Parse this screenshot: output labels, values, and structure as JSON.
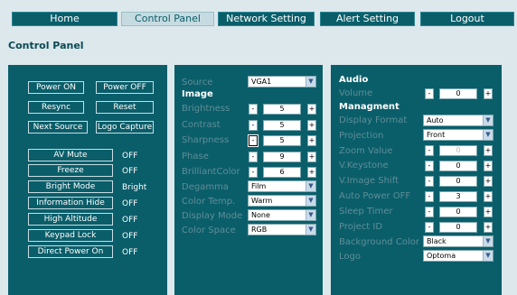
{
  "nav": {
    "home": "Home",
    "control_panel": "Control Panel",
    "network_setting": "Network Setting",
    "alert_setting": "Alert Setting",
    "logout": "Logout"
  },
  "page_title": "Control Panel",
  "left": {
    "power_on": "Power ON",
    "power_off": "Power OFF",
    "resync": "Resync",
    "reset": "Reset",
    "next_source": "Next Source",
    "logo_capture": "Logo Capture",
    "toggles": [
      {
        "label": "AV Mute",
        "value": "OFF"
      },
      {
        "label": "Freeze",
        "value": "OFF"
      },
      {
        "label": "Bright Mode",
        "value": "Bright"
      },
      {
        "label": "Information Hide",
        "value": "OFF"
      },
      {
        "label": "High Altitude",
        "value": "OFF"
      },
      {
        "label": "Keypad Lock",
        "value": "OFF"
      },
      {
        "label": "Direct Power On",
        "value": "OFF"
      }
    ]
  },
  "mid": {
    "source_label": "Source",
    "source_value": "VGA1",
    "image_heading": "Image",
    "brightness_label": "Brightness",
    "brightness_value": "5",
    "contrast_label": "Contrast",
    "contrast_value": "5",
    "sharpness_label": "Sharpness",
    "sharpness_value": "5",
    "phase_label": "Phase",
    "phase_value": "9",
    "brilliantcolor_label": "BrilliantColor",
    "brilliantcolor_value": "6",
    "degamma_label": "Degamma",
    "degamma_value": "Film",
    "color_temp_label": "Color Temp.",
    "color_temp_value": "Warm",
    "display_mode_label": "Display Mode",
    "display_mode_value": "None",
    "color_space_label": "Color Space",
    "color_space_value": "RGB"
  },
  "right": {
    "audio_heading": "Audio",
    "volume_label": "Volume",
    "volume_value": "0",
    "management_heading": "Managment",
    "display_format_label": "Display Format",
    "display_format_value": "Auto",
    "projection_label": "Projection",
    "projection_value": "Front",
    "zoom_label": "Zoom Value",
    "zoom_value": "0",
    "vkeystone_label": "V.Keystone",
    "vkeystone_value": "0",
    "vimageshift_label": "V.Image Shift",
    "vimageshift_value": "0",
    "autopoweroff_label": "Auto Power OFF",
    "autopoweroff_value": "3",
    "sleeptimer_label": "Sleep Timer",
    "sleeptimer_value": "0",
    "projectid_label": "Project ID",
    "projectid_value": "0",
    "bgcolor_label": "Background Color",
    "bgcolor_value": "Black",
    "logo_label": "Logo",
    "logo_value": "Optoma"
  },
  "glyphs": {
    "minus": "-",
    "plus": "+",
    "arrow": "▼"
  },
  "colors": {
    "panel": "#0a5e6a",
    "background": "#dce8ec",
    "active_tab": "#c6dbe1"
  }
}
